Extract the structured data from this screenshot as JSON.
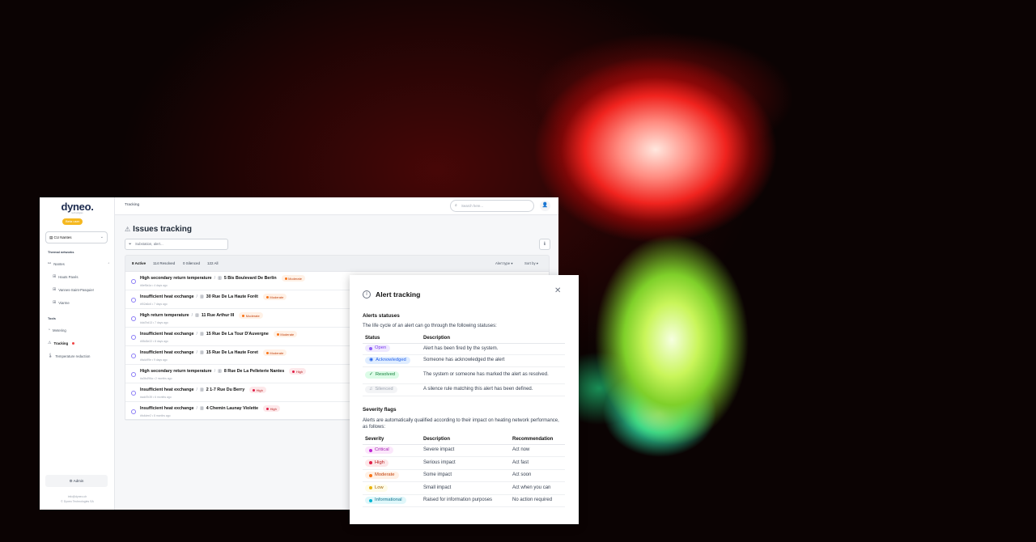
{
  "app": {
    "logo": "dyneo.",
    "logo_sub": "technologies",
    "beta_badge": "Beta user",
    "site": "CU Nantes"
  },
  "sidebar": {
    "section_networks": "Thermal networks",
    "network": "Nantes",
    "sub_items": [
      "Hauts Pavés",
      "Vannes-Saint-Pasquier",
      "Viarme"
    ],
    "section_tools": "Tools",
    "tools": [
      "Metering",
      "Tracking",
      "Temperature reduction"
    ],
    "admin": "Admin",
    "footer_email": "info@dyneo.ch",
    "footer_company": "© Dyneo Technologies SA"
  },
  "topbar": {
    "breadcrumb": "Tracking",
    "search_placeholder": "Search here..."
  },
  "page": {
    "title": "Issues tracking",
    "filter_placeholder": "Substation, alert..."
  },
  "counts": {
    "active": "8 Active",
    "resolved": "114 Resolved",
    "silenced": "0 Silenced",
    "all": "122 All"
  },
  "controls": {
    "alert_type": "Alert type ▾",
    "sort_by": "Sort by ▾"
  },
  "alerts": [
    {
      "title": "High secondary return temperature",
      "address": "5 Bis Boulevard De Berlin",
      "severity": "Moderate",
      "meta": "#6ef5a1a • 4 days ago"
    },
    {
      "title": "Insufficient heat exchange",
      "address": "30 Rue De La Haute Forêt",
      "severity": "Moderate",
      "meta": "#f02a6c6 • 7 days ago"
    },
    {
      "title": "High return temperature",
      "address": "11 Rue Arthur III",
      "severity": "Moderate",
      "meta": "#da7bd13 • 7 days ago"
    },
    {
      "title": "Insufficient heat exchange",
      "address": "15 Rue De La Tour D'Auvergne",
      "severity": "Moderate",
      "meta": "#55d3e22 • 8 days ago"
    },
    {
      "title": "Insufficient heat exchange",
      "address": "15 Rue De La Haute Foret",
      "severity": "Moderate",
      "meta": "#fa4c99e • 9 days ago"
    },
    {
      "title": "High secondary return temperature",
      "address": "8 Rue De La Pelleterie Nantes",
      "severity": "High",
      "meta": "#a3fc496a • 2 months ago"
    },
    {
      "title": "Insufficient heat exchange",
      "address": "2 1-7 Rue Du Berry",
      "severity": "High",
      "meta": "#add7b39 • 6 months ago"
    },
    {
      "title": "Insufficient heat exchange",
      "address": "4 Chemin Launay Violette",
      "severity": "High",
      "meta": "#fc4dee2 • 8 months ago"
    }
  ],
  "modal": {
    "title": "Alert tracking",
    "statuses_title": "Alerts statuses",
    "statuses_intro": "The life cycle of an alert can go through the following statuses:",
    "status_headers": [
      "Status",
      "Description"
    ],
    "statuses": [
      {
        "label": "Open",
        "desc": "Alert has been fired by the system."
      },
      {
        "label": "Acknowledged",
        "desc": "Someone has acknowledged the alert"
      },
      {
        "label": "Resolved",
        "desc": "The system or someone has marked the alert as resolved."
      },
      {
        "label": "Silenced",
        "desc": "A silence rule matching this alert has been defined."
      }
    ],
    "severity_title": "Severity flags",
    "severity_intro": "Alerts are automatically qualified according to their impact on heating network performance, as follows:",
    "severity_headers": [
      "Severity",
      "Description",
      "Recommendation"
    ],
    "severities": [
      {
        "label": "Critical",
        "desc": "Severe impact",
        "rec": "Act now"
      },
      {
        "label": "High",
        "desc": "Serious impact",
        "rec": "Act fast"
      },
      {
        "label": "Moderate",
        "desc": "Some impact",
        "rec": "Act soon"
      },
      {
        "label": "Low",
        "desc": "Small impact",
        "rec": "Act when you can"
      },
      {
        "label": "Informational",
        "desc": "Raised for information purposes",
        "rec": "No action required"
      }
    ]
  },
  "colors": {
    "accent": "#8b5cf6",
    "moderate": "#f97316",
    "high": "#e11d48",
    "beta": "#f5b820"
  }
}
